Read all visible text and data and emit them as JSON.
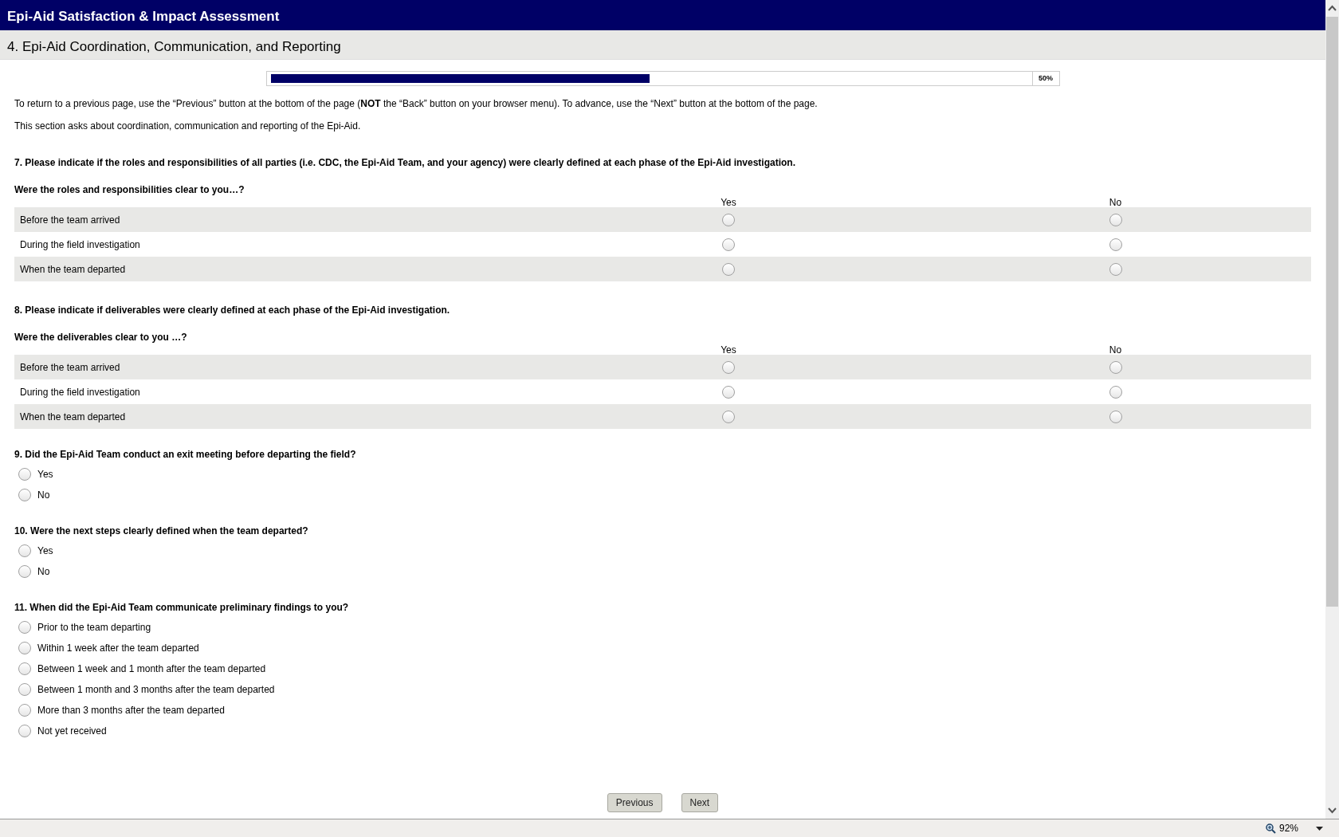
{
  "window": {
    "title": "Epi-Aid Satisfaction & Impact Assessment"
  },
  "section": {
    "title": "4. Epi-Aid Coordination, Communication, and Reporting"
  },
  "progress": {
    "level": 0.5,
    "reading": "50%"
  },
  "intro": [
    "To return to a previous page, use the “Previous” button at the bottom of the page (**NOT** the “Back” button on your browser menu). To advance, use the “Next” button at the bottom of the page.",
    "This section asks about coordination, communication and reporting of the Epi-Aid."
  ],
  "questions": [
    {
      "kind": "matrix",
      "title": "7. Please indicate if the roles and responsibilities of all parties (i.e. CDC, the Epi-Aid Team, and your agency) were clearly defined at each phase of the Epi-Aid investigation.",
      "subtitle": "Were the roles and responsibilities clear to you…?",
      "columns": [
        "Yes",
        "No"
      ],
      "rows": [
        {
          "label": "Before the team arrived",
          "choices": [
            {
              "selected": false
            },
            {
              "selected": false
            }
          ]
        },
        {
          "label": "During the field investigation",
          "choices": [
            {
              "selected": false
            },
            {
              "selected": false
            }
          ]
        },
        {
          "label": "When the team departed",
          "choices": [
            {
              "selected": false
            },
            {
              "selected": false
            }
          ]
        }
      ]
    },
    {
      "kind": "matrix",
      "title": "8. Please indicate if deliverables were clearly defined at each phase of the Epi-Aid investigation.",
      "subtitle": "Were the deliverables clear to you …?",
      "columns": [
        "Yes",
        "No"
      ],
      "rows": [
        {
          "label": "Before the team arrived",
          "choices": [
            {
              "selected": false
            },
            {
              "selected": false
            }
          ]
        },
        {
          "label": "During the field investigation",
          "choices": [
            {
              "selected": false
            },
            {
              "selected": false
            }
          ]
        },
        {
          "label": "When the team departed",
          "choices": [
            {
              "selected": false
            },
            {
              "selected": false
            }
          ]
        }
      ]
    },
    {
      "kind": "single",
      "title": "9. Did the Epi-Aid Team conduct an exit meeting before departing the field?",
      "options": [
        {
          "label": "Yes",
          "selected": false
        },
        {
          "label": "No",
          "selected": false
        }
      ]
    },
    {
      "kind": "single",
      "title": "10. Were the next steps clearly defined when the team departed?",
      "options": [
        {
          "label": "Yes",
          "selected": false
        },
        {
          "label": "No",
          "selected": false
        }
      ]
    },
    {
      "kind": "single",
      "title": "11. When did the Epi-Aid Team communicate preliminary findings to you?",
      "options": [
        {
          "label": "Prior to the team departing",
          "selected": false
        },
        {
          "label": "Within 1 week after the team departed",
          "selected": false
        },
        {
          "label": "Between 1 week and 1 month after the team departed",
          "selected": false
        },
        {
          "label": "Between 1 month and 3 months after the team departed",
          "selected": false
        },
        {
          "label": "More than 3 months after the team departed",
          "selected": false
        },
        {
          "label": "Not yet received",
          "selected": false
        }
      ]
    }
  ],
  "buttons": [
    "Previous",
    "Next"
  ],
  "status_bar": {
    "zoom": "92%"
  }
}
